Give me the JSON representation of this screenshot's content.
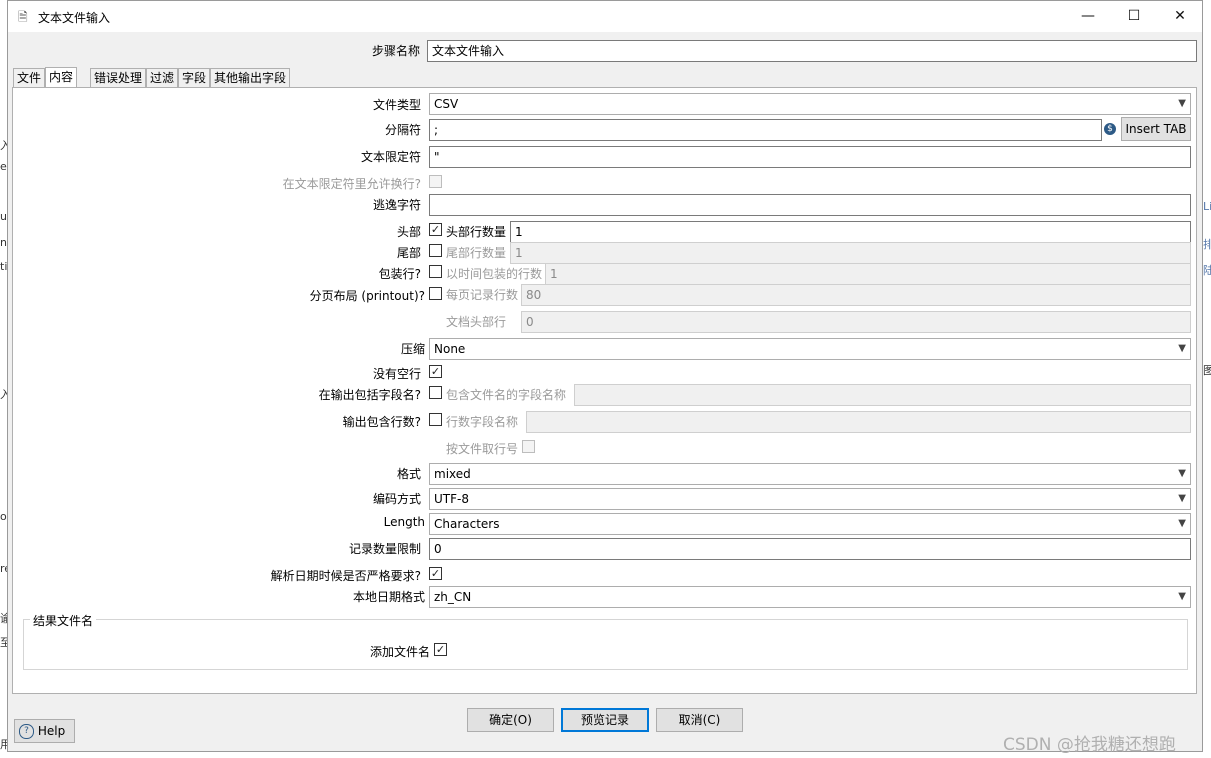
{
  "window": {
    "title": "文本文件输入",
    "minimize": "—",
    "maximize": "☐",
    "close": "✕"
  },
  "step_name": {
    "label": "步骤名称",
    "value": "文本文件输入"
  },
  "tabs": [
    {
      "label": "文件"
    },
    {
      "label": "内容"
    },
    {
      "label": "错误处理"
    },
    {
      "label": "过滤"
    },
    {
      "label": "字段"
    },
    {
      "label": "其他输出字段"
    }
  ],
  "content": {
    "file_type": {
      "label": "文件类型",
      "value": "CSV"
    },
    "separator": {
      "label": "分隔符",
      "value": ";",
      "insert_tab": "Insert TAB"
    },
    "enclosure": {
      "label": "文本限定符",
      "value": "\""
    },
    "allow_breaks": {
      "label": "在文本限定符里允许换行?"
    },
    "escape": {
      "label": "逃逸字符",
      "value": ""
    },
    "header": {
      "label": "头部",
      "checked": "✓",
      "count_label": "头部行数量",
      "count": "1"
    },
    "footer": {
      "label": "尾部",
      "count_label": "尾部行数量",
      "count": "1"
    },
    "wrapped": {
      "label": "包装行?",
      "count_label": "以时间包装的行数",
      "count": "1"
    },
    "paged": {
      "label": "分页布局 (printout)?",
      "per_page_label": "每页记录行数",
      "per_page": "80",
      "doc_header_label": "文档头部行",
      "doc_header": "0"
    },
    "compression": {
      "label": "压缩",
      "value": "None"
    },
    "no_empty": {
      "label": "没有空行",
      "checked": "✓"
    },
    "include_filename": {
      "label": "在输出包括字段名?",
      "field_label": "包含文件名的字段名称"
    },
    "include_rownum": {
      "label": "输出包含行数?",
      "field_label": "行数字段名称",
      "per_file_label": "按文件取行号"
    },
    "format": {
      "label": "格式",
      "value": "mixed"
    },
    "encoding": {
      "label": "编码方式",
      "value": "UTF-8"
    },
    "length": {
      "label": "Length",
      "value": "Characters"
    },
    "limit": {
      "label": "记录数量限制",
      "value": "0"
    },
    "lenient_dates": {
      "label": "解析日期时候是否严格要求?",
      "checked": "✓"
    },
    "locale": {
      "label": "本地日期格式",
      "value": "zh_CN"
    }
  },
  "result_group": {
    "title": "结果文件名",
    "add_filename": {
      "label": "添加文件名",
      "checked": "✓"
    }
  },
  "buttons": {
    "ok": "确定(O)",
    "preview": "预览记录",
    "cancel": "取消(C)",
    "help": "Help"
  },
  "watermark": "CSDN @抢我糖还想跑"
}
